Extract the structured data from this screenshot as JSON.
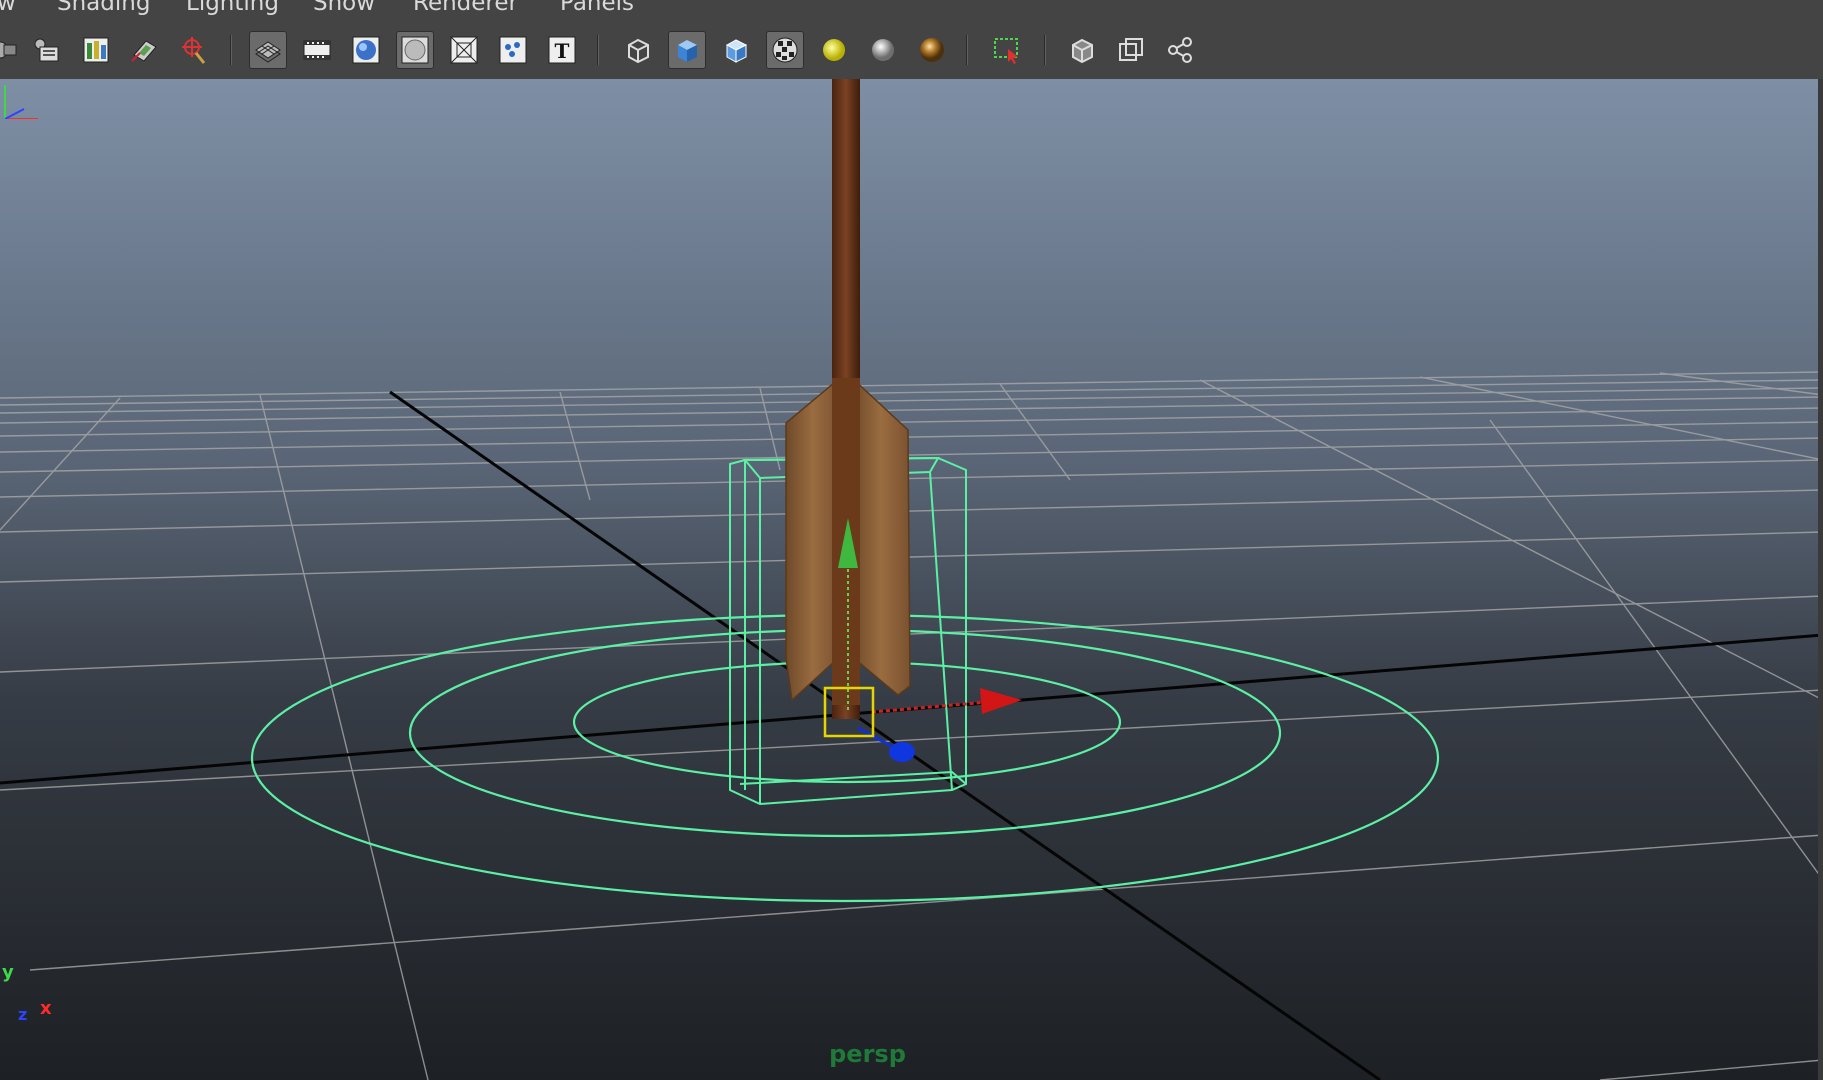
{
  "menu": [
    "w",
    "Shading",
    "Lighting",
    "Show",
    "Renderer",
    "Panels"
  ],
  "toolbar_icons": [
    "camera-attributes-icon",
    "bookmark-icon",
    "image-plane-icon",
    "2d-pan-zoom-icon",
    "grease-pencil-icon",
    "grid-icon",
    "film-gate-icon",
    "resolution-gate-icon",
    "gate-mask-icon",
    "field-chart-icon",
    "safe-action-icon",
    "safe-title-icon",
    "wireframe-icon",
    "smooth-shade-icon",
    "wireframe-on-shaded-icon",
    "textured-icon",
    "use-all-lights-icon",
    "shadows-icon",
    "default-material-icon",
    "isolate-select-icon",
    "xray-icon",
    "xray-active-components-icon",
    "xray-joints-icon"
  ],
  "viewport": {
    "camera_label": "persp",
    "axis_labels": {
      "y": "y",
      "z": "z",
      "x": "x"
    },
    "colors": {
      "sky_top": "#7d8ea4",
      "sky_bottom": "#3a4048",
      "ground": "#23272c",
      "grid": "#9a9a9a",
      "selection": "#5cf0a5",
      "arrow_wood": "#5e3016",
      "fletching": "#8a6036"
    }
  }
}
